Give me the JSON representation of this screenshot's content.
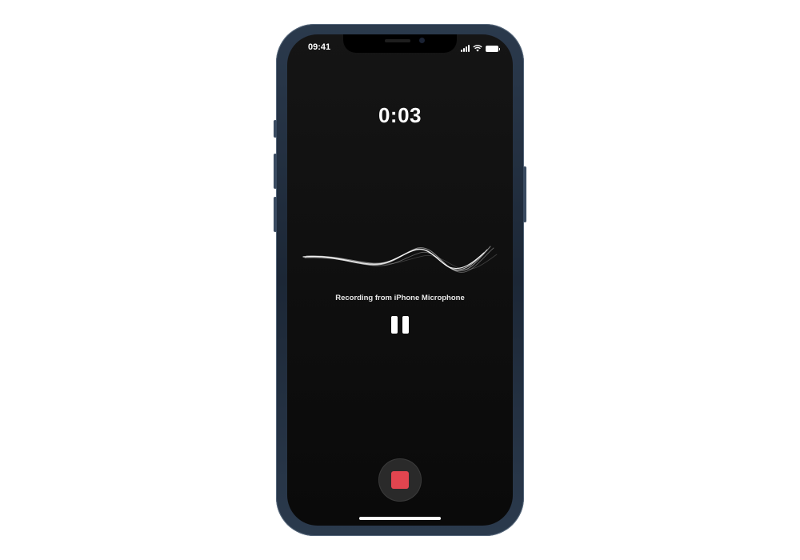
{
  "status_bar": {
    "time": "09:41",
    "icons": [
      "cellular-signal-icon",
      "wifi-icon",
      "battery-icon"
    ]
  },
  "recorder": {
    "elapsed": "0:03",
    "source_label": "Recording from iPhone Microphone",
    "pause_icon": "pause-icon",
    "stop_icon": "stop-icon"
  },
  "colors": {
    "screen_background": "#0e0e0e",
    "stop_accent": "#e0454f",
    "phone_frame": "#1c2736"
  }
}
